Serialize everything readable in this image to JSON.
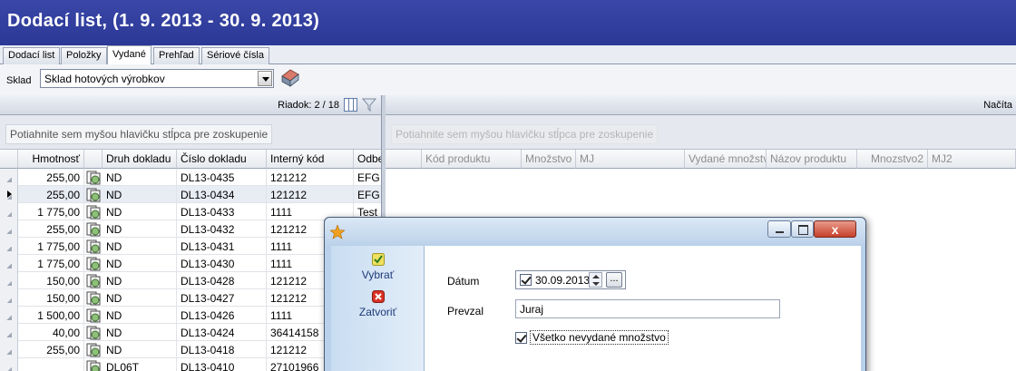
{
  "window": {
    "title": "Dodací list,  (1. 9. 2013 - 30. 9. 2013)"
  },
  "tabs": [
    {
      "label": "Dodací list",
      "active": false
    },
    {
      "label": "Položky",
      "active": false
    },
    {
      "label": "Vydané",
      "active": true
    },
    {
      "label": "Prehľad",
      "active": false
    },
    {
      "label": "Sériové čísla",
      "active": false
    }
  ],
  "sklad": {
    "label": "Sklad",
    "value": "Sklad hotových výrobkov",
    "icon": "warehouse-icon"
  },
  "left_grid": {
    "record_counter": "Riadok: 2 / 18",
    "group_hint": "Potiahnite sem myšou hlavičku stĺpca pre zoskupenie",
    "columns": [
      "Hmotnosť",
      "Druh dokladu",
      "Číslo dokladu",
      "Interný kód",
      "Odbe"
    ],
    "rows": [
      {
        "hmotnost": "255,00",
        "druh": "ND",
        "cislo": "DL13-0435",
        "kod": "121212",
        "odbe": "EFG"
      },
      {
        "hmotnost": "255,00",
        "druh": "ND",
        "cislo": "DL13-0434",
        "kod": "121212",
        "odbe": "EFG"
      },
      {
        "hmotnost": "1 775,00",
        "druh": "ND",
        "cislo": "DL13-0433",
        "kod": "1111",
        "odbe": "Test"
      },
      {
        "hmotnost": "255,00",
        "druh": "ND",
        "cislo": "DL13-0432",
        "kod": "121212",
        "odbe": ""
      },
      {
        "hmotnost": "1 775,00",
        "druh": "ND",
        "cislo": "DL13-0431",
        "kod": "1111",
        "odbe": ""
      },
      {
        "hmotnost": "1 775,00",
        "druh": "ND",
        "cislo": "DL13-0430",
        "kod": "1111",
        "odbe": ""
      },
      {
        "hmotnost": "150,00",
        "druh": "ND",
        "cislo": "DL13-0428",
        "kod": "121212",
        "odbe": ""
      },
      {
        "hmotnost": "150,00",
        "druh": "ND",
        "cislo": "DL13-0427",
        "kod": "121212",
        "odbe": ""
      },
      {
        "hmotnost": "1 500,00",
        "druh": "ND",
        "cislo": "DL13-0426",
        "kod": "1111",
        "odbe": ""
      },
      {
        "hmotnost": "40,00",
        "druh": "ND",
        "cislo": "DL13-0424",
        "kod": "36414158",
        "odbe": ""
      },
      {
        "hmotnost": "255,00",
        "druh": "ND",
        "cislo": "DL13-0418",
        "kod": "121212",
        "odbe": ""
      },
      {
        "hmotnost": "",
        "druh": "DL06T",
        "cislo": "DL13-0410",
        "kod": "27101966",
        "odbe": ""
      }
    ]
  },
  "right_grid": {
    "header_text": "Načíta",
    "group_hint": "Potiahnite sem myšou hlavičku stĺpca pre zoskupenie",
    "columns": [
      "Kód produktu",
      "Množstvo",
      "MJ",
      "Vydané množstvo",
      "Názov produktu",
      "Mnozstvo2",
      "MJ2"
    ]
  },
  "dialog": {
    "select_label": "Vybrať",
    "close_label": "Zatvoriť",
    "date_label": "Dátum",
    "date_value": "30.09.2013",
    "date_browse": "...",
    "prevzal_label": "Prevzal",
    "prevzal_value": "Juraj",
    "all_label": "Všetko nevydané množstvo",
    "close_glyph": "x"
  },
  "colors": {
    "title_bar": "#2f3c9c",
    "dialog_frame": "#b9d1ea",
    "select_icon": "#e6d93a",
    "close_icon": "#d93025"
  }
}
